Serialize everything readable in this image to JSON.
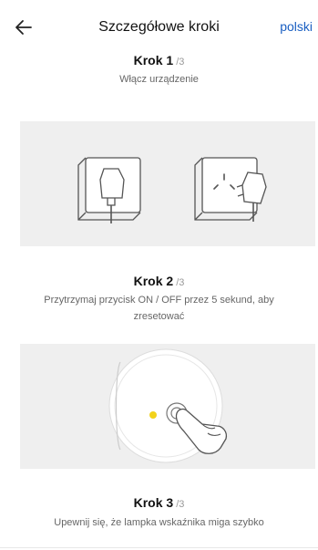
{
  "header": {
    "title": "Szczegółowe kroki",
    "language": "polski",
    "back_icon": "arrow-left-icon"
  },
  "steps": [
    {
      "title": "Krok 1",
      "total": "/3",
      "description": "Włącz urządzenie",
      "illustration": "plug-into-socket"
    },
    {
      "title": "Krok 2",
      "total": "/3",
      "description": "Przytrzymaj przycisk ON / OFF przez 5 sekund, aby zresetować",
      "illustration": "press-reset-button"
    },
    {
      "title": "Krok 3",
      "total": "/3",
      "description": "Upewnij się, że lampka wskaźnika miga szybko"
    }
  ],
  "colors": {
    "accent_link": "#1a5fc2",
    "indicator_light": "#f2d21b",
    "illustration_bg": "#efefef"
  }
}
